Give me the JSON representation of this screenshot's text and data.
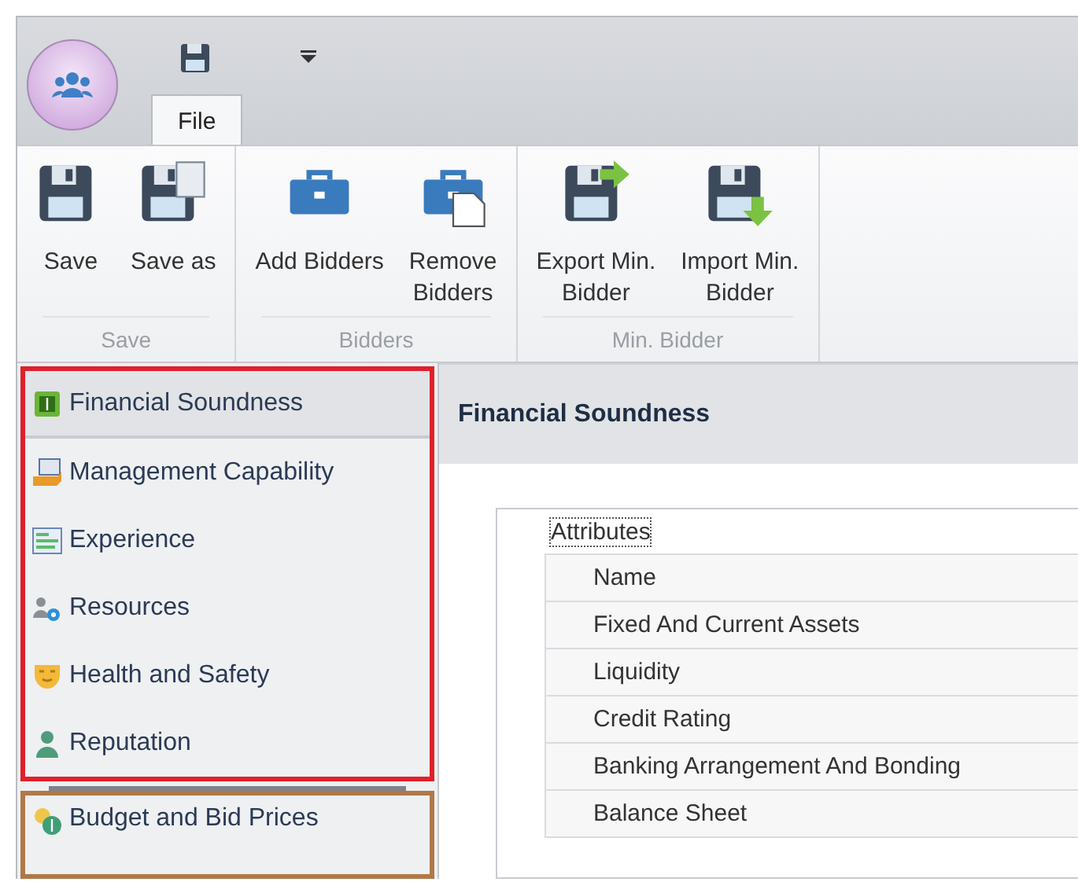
{
  "app_menu": {
    "tab": "File"
  },
  "ribbon_groups": [
    {
      "label": "Save",
      "buttons": [
        "Save",
        "Save as"
      ]
    },
    {
      "label": "Bidders",
      "buttons": [
        "Add Bidders",
        "Remove\nBidders"
      ]
    },
    {
      "label": "Min. Bidder",
      "buttons": [
        "Export Min.\nBidder",
        "Import Min.\nBidder"
      ]
    }
  ],
  "nav_groups": [
    {
      "color": "#e0202a",
      "items": [
        {
          "label": "Financial Soundness",
          "selected": true
        },
        {
          "label": "Management Capability",
          "selected": false
        },
        {
          "label": "Experience",
          "selected": false
        },
        {
          "label": "Resources",
          "selected": false
        },
        {
          "label": "Health and Safety",
          "selected": false
        },
        {
          "label": "Reputation",
          "selected": false
        }
      ]
    },
    {
      "color": "#b07848",
      "items": [
        {
          "label": "Budget and Bid Prices",
          "selected": false
        }
      ]
    }
  ],
  "panel": {
    "title": "Financial Soundness",
    "table": {
      "header": "Attributes",
      "rows": [
        "Name",
        "Fixed And Current Assets",
        "Liquidity",
        "Credit Rating",
        "Banking Arrangement And Bonding",
        "Balance Sheet"
      ]
    }
  }
}
